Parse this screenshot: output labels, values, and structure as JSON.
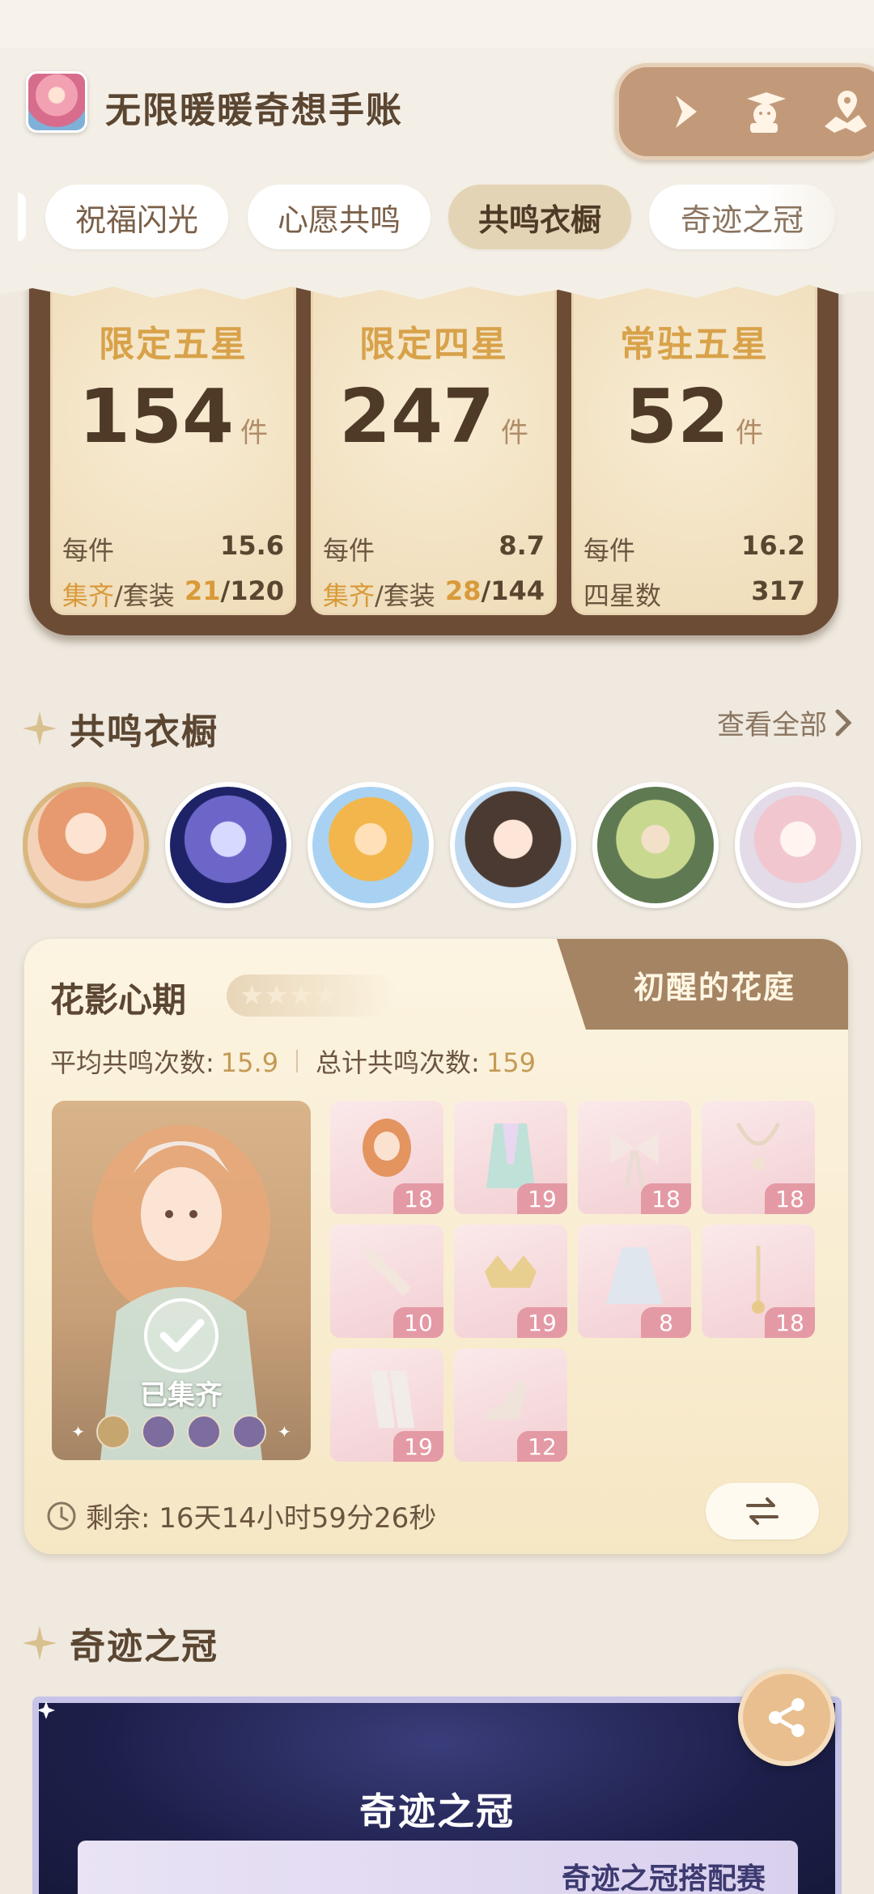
{
  "app": {
    "title": "无限暖暖奇想手账"
  },
  "toolbar": {
    "icons": [
      "play-icon",
      "graduate-dog-icon",
      "map-pin-icon"
    ]
  },
  "tabs": [
    {
      "label": "祝福闪光",
      "active": false
    },
    {
      "label": "心愿共鸣",
      "active": false
    },
    {
      "label": "共鸣衣橱",
      "active": true
    },
    {
      "label": "奇迹之冠",
      "active": false
    }
  ],
  "stats": [
    {
      "title": "限定五星",
      "count": "154",
      "unit": "件",
      "per_label": "每件",
      "per_value": "15.6",
      "row2": {
        "collected": "集齐",
        "set_label": "/套装 ",
        "done": "21",
        "total": "/120"
      }
    },
    {
      "title": "限定四星",
      "count": "247",
      "unit": "件",
      "per_label": "每件",
      "per_value": "8.7",
      "row2": {
        "collected": "集齐",
        "set_label": "/套装 ",
        "done": "28",
        "total": "/144"
      }
    },
    {
      "title": "常驻五星",
      "count": "52",
      "unit": "件",
      "per_label": "每件",
      "per_value": "16.2",
      "row2_alt": {
        "label": "四星数",
        "value": "317"
      }
    }
  ],
  "wardrobe_section": {
    "title": "共鸣衣橱",
    "view_all": "查看全部"
  },
  "avatars": {
    "count": 6,
    "selected_index": 0
  },
  "set_card": {
    "name": "花影心期",
    "stars": "★★★★★",
    "ribbon": "初醒的花庭",
    "avg_label": "平均共鸣次数:",
    "avg_value": "15.9",
    "total_label": "总计共鸣次数:",
    "total_value": "159",
    "portrait_label": "已集齐",
    "items": [
      "18",
      "19",
      "18",
      "18",
      "10",
      "19",
      "8",
      "18",
      "19",
      "12"
    ],
    "timer": "剩余: 16天14小时59分26秒"
  },
  "crown_section": {
    "title": "奇迹之冠",
    "card_title": "奇迹之冠",
    "card_subtitle": "奇迹之冠搭配赛"
  },
  "colors": {
    "accent_gold": "#d99a3a",
    "panel_brown": "#6d4c36",
    "badge_pink": "#e49aa5"
  }
}
